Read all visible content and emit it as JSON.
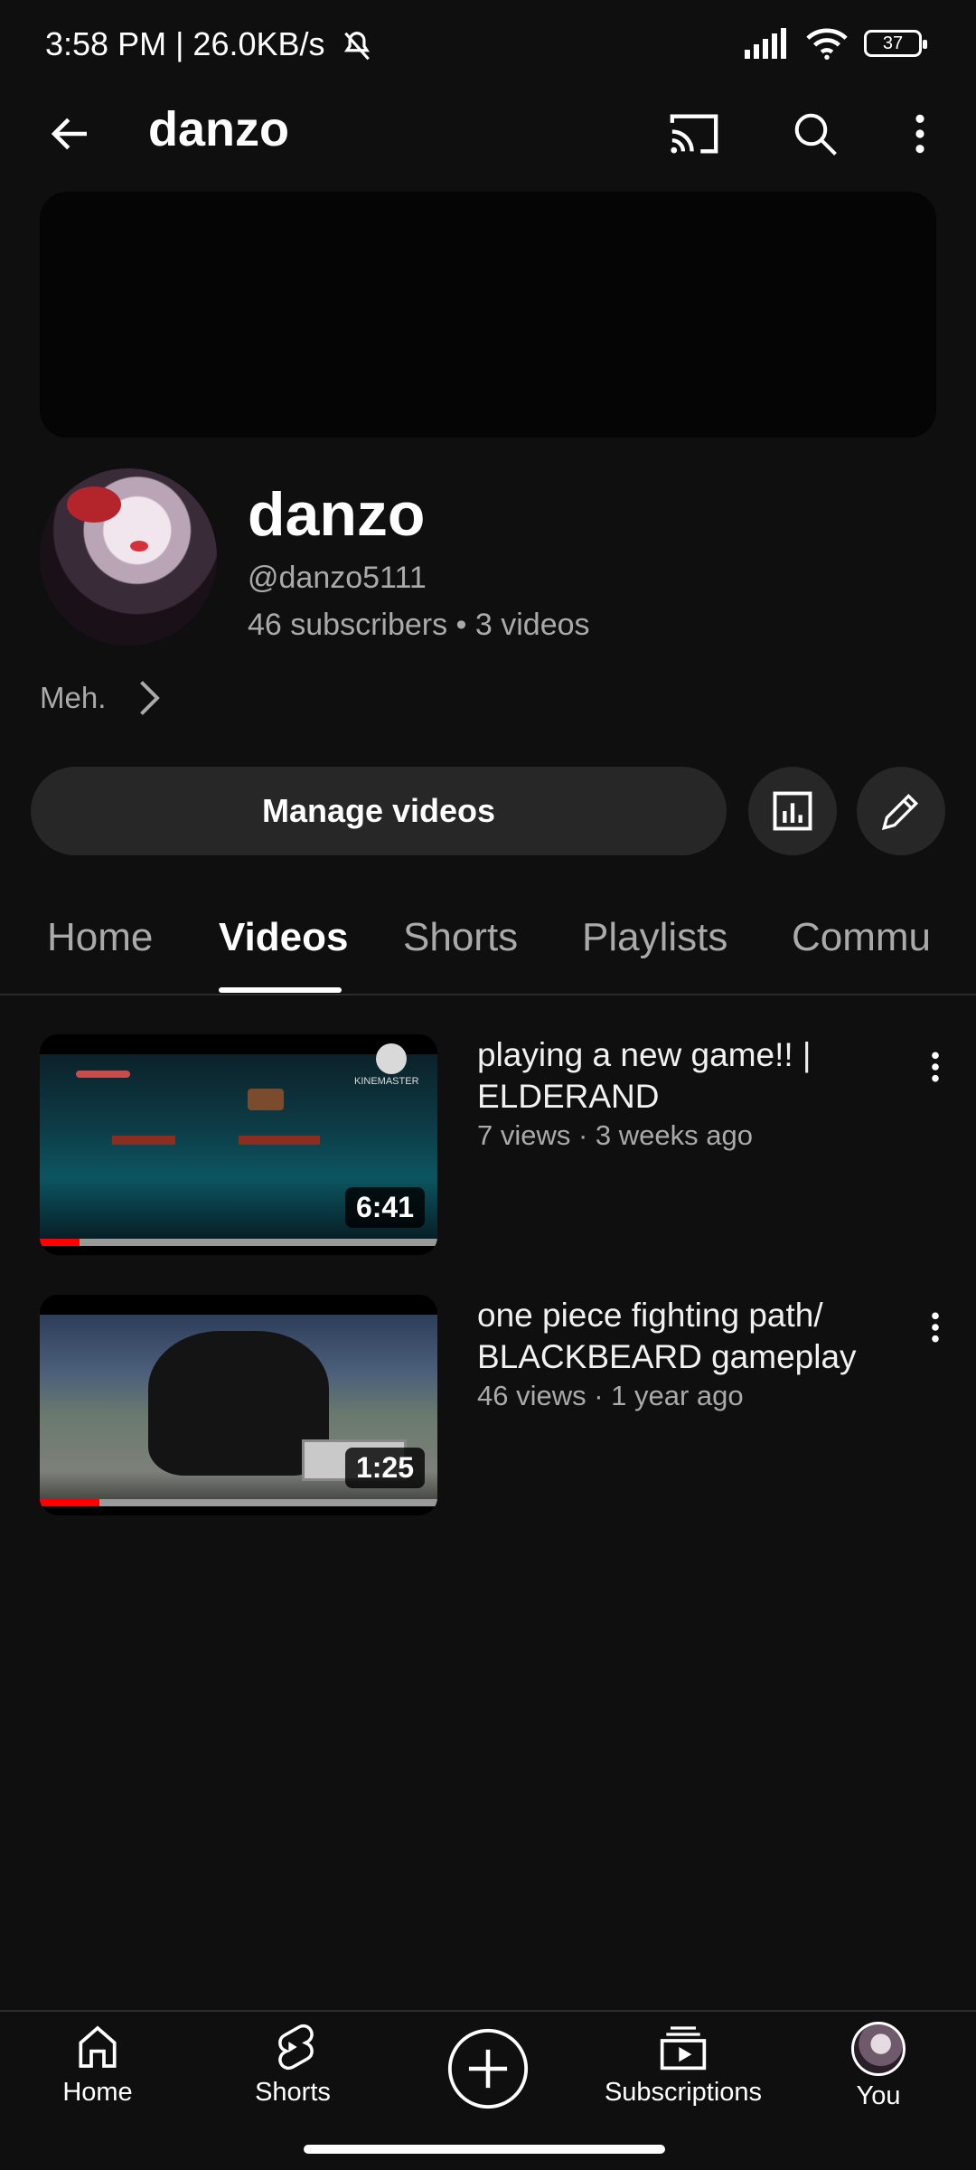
{
  "status_bar": {
    "left_text": "3:58 PM | 26.0KB/s",
    "battery": "37"
  },
  "header": {
    "title": "danzo"
  },
  "channel": {
    "name": "danzo",
    "handle": "@danzo5111",
    "stats": "46 subscribers • 3 videos",
    "description": "Meh."
  },
  "actions": {
    "manage_label": "Manage videos"
  },
  "tabs": [
    {
      "label": "Home"
    },
    {
      "label": "Videos"
    },
    {
      "label": "Shorts"
    },
    {
      "label": "Playlists"
    },
    {
      "label": "Commu"
    }
  ],
  "videos": [
    {
      "title": "playing a new game!! | ELDERAND",
      "meta": "7 views · 3 weeks ago",
      "duration": "6:41",
      "watched_fraction": 0.1,
      "thumb_text": "KINEMASTER"
    },
    {
      "title": "one piece fighting path/ BLACKBEARD gameplay",
      "meta": "46 views · 1 year ago",
      "duration": "1:25",
      "watched_fraction": 0.15
    }
  ],
  "bottom_nav": [
    {
      "label": "Home",
      "icon": "home-icon"
    },
    {
      "label": "Shorts",
      "icon": "shorts-icon"
    },
    {
      "label": "",
      "icon": "create-icon"
    },
    {
      "label": "Subscriptions",
      "icon": "subscriptions-icon"
    },
    {
      "label": "You",
      "icon": "avatar"
    }
  ],
  "colors": {
    "background": "#0f0f0f",
    "progress": "#ff0000",
    "muted_text": "#aaaaaa"
  }
}
